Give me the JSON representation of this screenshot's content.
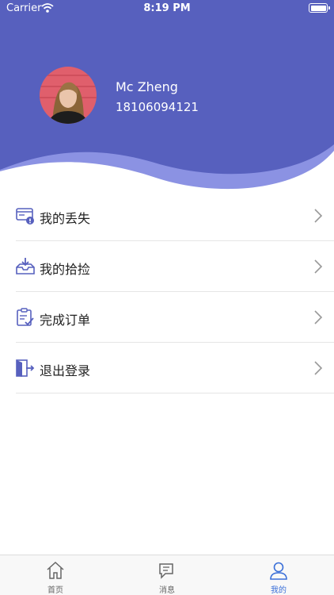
{
  "status_bar": {
    "carrier": "Carrier",
    "time": "8:19 PM"
  },
  "profile": {
    "name": "Mc Zheng",
    "phone": "18106094121"
  },
  "menu": {
    "items": [
      {
        "label": "我的丢失",
        "icon": "lost-card-icon"
      },
      {
        "label": "我的拾捡",
        "icon": "found-inbox-icon"
      },
      {
        "label": "完成订单",
        "icon": "completed-order-icon"
      },
      {
        "label": "退出登录",
        "icon": "logout-door-icon"
      }
    ]
  },
  "tabbar": {
    "tabs": [
      {
        "label": "首页",
        "icon": "home-icon",
        "active": false
      },
      {
        "label": "消息",
        "icon": "message-icon",
        "active": false
      },
      {
        "label": "我的",
        "icon": "user-icon",
        "active": true
      }
    ]
  },
  "colors": {
    "header": "#5760be",
    "wave_light": "#8b92e3",
    "accent": "#3a6fd8"
  }
}
